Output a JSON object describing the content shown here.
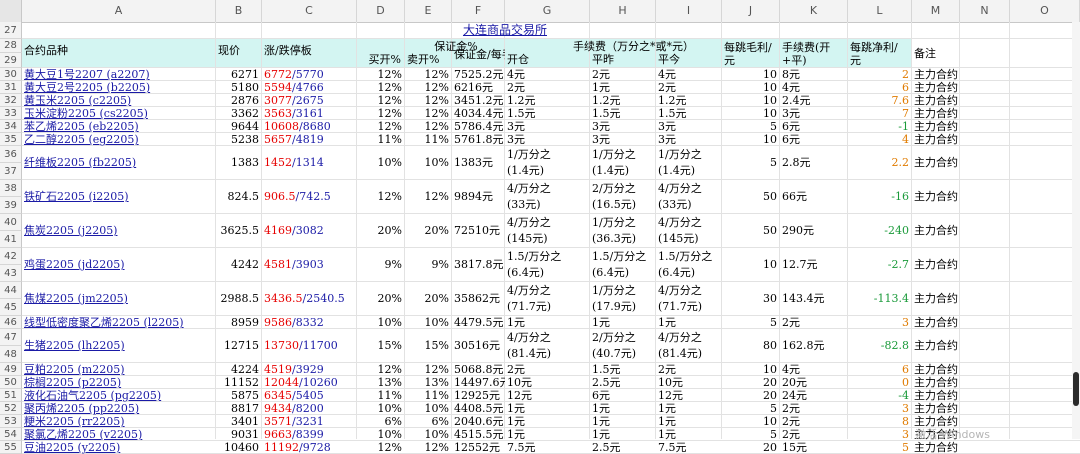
{
  "columns": [
    "A",
    "B",
    "C",
    "D",
    "E",
    "F",
    "G",
    "H",
    "I",
    "J",
    "K",
    "L",
    "M",
    "N",
    "O"
  ],
  "title": "大连商品交易所",
  "headers": {
    "variety": "合约品种",
    "price": "现价",
    "limit": "涨/跌停板",
    "margin_group": "保证金%",
    "buy_open": "买开%",
    "sell_open": "卖开%",
    "margin_per_lot": "保证金/每手",
    "fee_group": "手续费（万分之*或*元）",
    "open": "开仓",
    "close_yest": "平昨",
    "close_today": "平今",
    "tick_gross_line1": "每跳毛利/",
    "tick_gross_line2": "元",
    "fee_open_close_line1": "手续费(开",
    "fee_open_close_line2": "+平)",
    "tick_net_line1": "每跳净利/",
    "tick_net_line2": "元",
    "note": "备注"
  },
  "rows": [
    {
      "n": "30",
      "name": "黄大豆1号2207 (a2207)",
      "price": "6271",
      "up": "6772",
      "down": "5770",
      "buy": "12%",
      "sell": "12%",
      "margin": "7525.2元",
      "open": "4元",
      "closey": "2元",
      "closet": "4元",
      "gross": "10",
      "fee": "8元",
      "net": "2",
      "netc": "orange",
      "note": "主力合约"
    },
    {
      "n": "31",
      "name": "黄大豆2号2205 (b2205)",
      "price": "5180",
      "up": "5594",
      "down": "4766",
      "buy": "12%",
      "sell": "12%",
      "margin": "6216元",
      "open": "2元",
      "closey": "1元",
      "closet": "2元",
      "gross": "10",
      "fee": "4元",
      "net": "6",
      "netc": "orange",
      "note": "主力合约"
    },
    {
      "n": "32",
      "name": "黄玉米2205 (c2205)",
      "price": "2876",
      "up": "3077",
      "down": "2675",
      "buy": "12%",
      "sell": "12%",
      "margin": "3451.2元",
      "open": "1.2元",
      "closey": "1.2元",
      "closet": "1.2元",
      "gross": "10",
      "fee": "2.4元",
      "net": "7.6",
      "netc": "orange",
      "note": "主力合约"
    },
    {
      "n": "33",
      "name": "玉米淀粉2205 (cs2205)",
      "price": "3362",
      "up": "3563",
      "down": "3161",
      "buy": "12%",
      "sell": "12%",
      "margin": "4034.4元",
      "open": "1.5元",
      "closey": "1.5元",
      "closet": "1.5元",
      "gross": "10",
      "fee": "3元",
      "net": "7",
      "netc": "orange",
      "note": "主力合约"
    },
    {
      "n": "34",
      "name": "苯乙烯2205 (eb2205)",
      "price": "9644",
      "up": "10608",
      "down": "8680",
      "buy": "12%",
      "sell": "12%",
      "margin": "5786.4元",
      "open": "3元",
      "closey": "3元",
      "closet": "3元",
      "gross": "5",
      "fee": "6元",
      "net": "-1",
      "netc": "green",
      "note": "主力合约"
    },
    {
      "n": "35",
      "name": "乙二醇2205 (eg2205)",
      "price": "5238",
      "up": "5657",
      "down": "4819",
      "buy": "11%",
      "sell": "11%",
      "margin": "5761.8元",
      "open": "3元",
      "closey": "3元",
      "closet": "3元",
      "gross": "10",
      "fee": "6元",
      "net": "4",
      "netc": "orange",
      "note": "主力合约"
    },
    {
      "n": "36/37",
      "name": "纤维板2205 (fb2205)",
      "price": "1383",
      "up": "1452",
      "down": "1314",
      "buy": "10%",
      "sell": "10%",
      "margin": "1383元",
      "open": "1/万分之|(1.4元)",
      "closey": "1/万分之|(1.4元)",
      "closet": "1/万分之|(1.4元)",
      "gross": "5",
      "fee": "2.8元",
      "net": "2.2",
      "netc": "orange",
      "note": "主力合约"
    },
    {
      "n": "38/39",
      "name": "铁矿石2205 (i2205)",
      "price": "824.5",
      "up": "906.5",
      "down": "742.5",
      "buy": "12%",
      "sell": "12%",
      "margin": "9894元",
      "open": "4/万分之|(33元)",
      "closey": "2/万分之|(16.5元)",
      "closet": "4/万分之|(33元)",
      "gross": "50",
      "fee": "66元",
      "net": "-16",
      "netc": "green",
      "note": "主力合约"
    },
    {
      "n": "40/41",
      "name": "焦炭2205 (j2205)",
      "price": "3625.5",
      "up": "4169",
      "down": "3082",
      "buy": "20%",
      "sell": "20%",
      "margin": "72510元",
      "open": "4/万分之|(145元)",
      "closey": "1/万分之|(36.3元)",
      "closet": "4/万分之|(145元)",
      "gross": "50",
      "fee": "290元",
      "net": "-240",
      "netc": "green",
      "note": "主力合约"
    },
    {
      "n": "42/43",
      "name": "鸡蛋2205 (jd2205)",
      "price": "4242",
      "up": "4581",
      "down": "3903",
      "buy": "9%",
      "sell": "9%",
      "margin": "3817.8元",
      "open": "1.5/万分之|(6.4元)",
      "closey": "1.5/万分之|(6.4元)",
      "closet": "1.5/万分之|(6.4元)",
      "gross": "10",
      "fee": "12.7元",
      "net": "-2.7",
      "netc": "green",
      "note": "主力合约"
    },
    {
      "n": "44/45",
      "name": "焦煤2205 (jm2205)",
      "price": "2988.5",
      "up": "3436.5",
      "down": "2540.5",
      "buy": "20%",
      "sell": "20%",
      "margin": "35862元",
      "open": "4/万分之|(71.7元)",
      "closey": "1/万分之|(17.9元)",
      "closet": "4/万分之|(71.7元)",
      "gross": "30",
      "fee": "143.4元",
      "net": "-113.4",
      "netc": "green",
      "note": "主力合约"
    },
    {
      "n": "46",
      "name": "线型低密度聚乙烯2205 (l2205)",
      "price": "8959",
      "up": "9586",
      "down": "8332",
      "buy": "10%",
      "sell": "10%",
      "margin": "4479.5元",
      "open": "1元",
      "closey": "1元",
      "closet": "1元",
      "gross": "5",
      "fee": "2元",
      "net": "3",
      "netc": "orange",
      "note": "主力合约"
    },
    {
      "n": "47/48",
      "name": "生猪2205 (lh2205)",
      "price": "12715",
      "up": "13730",
      "down": "11700",
      "buy": "15%",
      "sell": "15%",
      "margin": "30516元",
      "open": "4/万分之|(81.4元)",
      "closey": "2/万分之|(40.7元)",
      "closet": "4/万分之|(81.4元)",
      "gross": "80",
      "fee": "162.8元",
      "net": "-82.8",
      "netc": "green",
      "note": "主力合约"
    },
    {
      "n": "49",
      "name": "豆粕2205 (m2205)",
      "price": "4224",
      "up": "4519",
      "down": "3929",
      "buy": "12%",
      "sell": "12%",
      "margin": "5068.8元",
      "open": "2元",
      "closey": "1.5元",
      "closet": "2元",
      "gross": "10",
      "fee": "4元",
      "net": "6",
      "netc": "orange",
      "note": "主力合约"
    },
    {
      "n": "50",
      "name": "棕榈2205 (p2205)",
      "price": "11152",
      "up": "12044",
      "down": "10260",
      "buy": "13%",
      "sell": "13%",
      "margin": "14497.6元",
      "open": "10元",
      "closey": "2.5元",
      "closet": "10元",
      "gross": "20",
      "fee": "20元",
      "net": "0",
      "netc": "orange",
      "note": "主力合约"
    },
    {
      "n": "51",
      "name": "液化石油气2205 (pg2205)",
      "price": "5875",
      "up": "6345",
      "down": "5405",
      "buy": "11%",
      "sell": "11%",
      "margin": "12925元",
      "open": "12元",
      "closey": "6元",
      "closet": "12元",
      "gross": "20",
      "fee": "24元",
      "net": "-4",
      "netc": "green",
      "note": "主力合约"
    },
    {
      "n": "52",
      "name": "聚丙烯2205 (pp2205)",
      "price": "8817",
      "up": "9434",
      "down": "8200",
      "buy": "10%",
      "sell": "10%",
      "margin": "4408.5元",
      "open": "1元",
      "closey": "1元",
      "closet": "1元",
      "gross": "5",
      "fee": "2元",
      "net": "3",
      "netc": "orange",
      "note": "主力合约"
    },
    {
      "n": "53",
      "name": "粳米2205 (rr2205)",
      "price": "3401",
      "up": "3571",
      "down": "3231",
      "buy": "6%",
      "sell": "6%",
      "margin": "2040.6元",
      "open": "1元",
      "closey": "1元",
      "closet": "1元",
      "gross": "10",
      "fee": "2元",
      "net": "8",
      "netc": "orange",
      "note": "主力合约"
    },
    {
      "n": "54",
      "name": "聚氯乙烯2205 (v2205)",
      "price": "9031",
      "up": "9663",
      "down": "8399",
      "buy": "10%",
      "sell": "10%",
      "margin": "4515.5元",
      "open": "1元",
      "closey": "1元",
      "closet": "1元",
      "gross": "5",
      "fee": "2元",
      "net": "3",
      "netc": "orange",
      "note": "主力合约"
    },
    {
      "n": "55",
      "name": "豆油2205 (y2205)",
      "price": "10460",
      "up": "11192",
      "down": "9728",
      "buy": "12%",
      "sell": "12%",
      "margin": "12552元",
      "open": "7.5元",
      "closey": "2.5元",
      "closet": "7.5元",
      "gross": "20",
      "fee": "15元",
      "net": "5",
      "netc": "orange",
      "note": "主力合约"
    }
  ],
  "row_numbers": [
    "27",
    "28",
    "29"
  ],
  "watermark": "激活 Windows",
  "colors": {
    "header_bg": "#d3f5f2",
    "link": "#1a1aa6",
    "up": "#e60000",
    "net_pos": "#e07b00",
    "net_neg": "#1a9a3a"
  }
}
